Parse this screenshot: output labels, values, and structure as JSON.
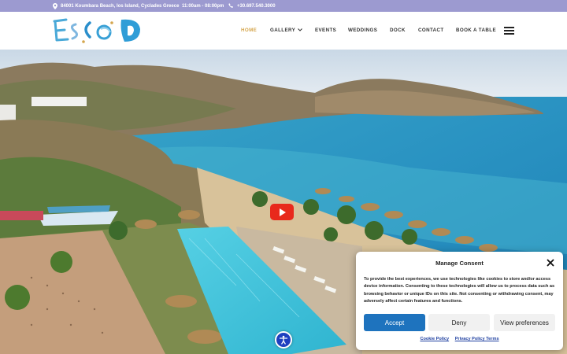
{
  "topbar": {
    "address": "84001 Koumbara Beach, Ios Island, Cyclades Greece",
    "hours": "11:00am - 08:00pm",
    "phone": "+30.697.540.3000"
  },
  "header": {
    "logo_text": "ESCO",
    "nav": [
      {
        "label": "HOME"
      },
      {
        "label": "GALLERY"
      },
      {
        "label": "EVENTS"
      },
      {
        "label": "WEDDINGS"
      },
      {
        "label": "DOCK"
      },
      {
        "label": "CONTACT"
      },
      {
        "label": "BOOK A TABLE"
      }
    ]
  },
  "consent": {
    "title": "Manage Consent",
    "body": "To provide the best experiences, we use technologies like cookies to store and/or access device information. Consenting to these technologies will allow us to process data such as browsing behavior or unique IDs on this site. Not consenting or withdrawing consent, may adversely affect certain features and functions.",
    "accept": "Accept",
    "deny": "Deny",
    "preferences": "View preferences",
    "cookie_policy": "Cookie Policy",
    "privacy_policy": "Privacy Policy Terms"
  },
  "colors": {
    "topbar": "#9c9ad0",
    "nav_active": "#d5a54c",
    "accept": "#1e73be",
    "youtube": "#e8291c",
    "accessibility": "#1d3fbf"
  }
}
